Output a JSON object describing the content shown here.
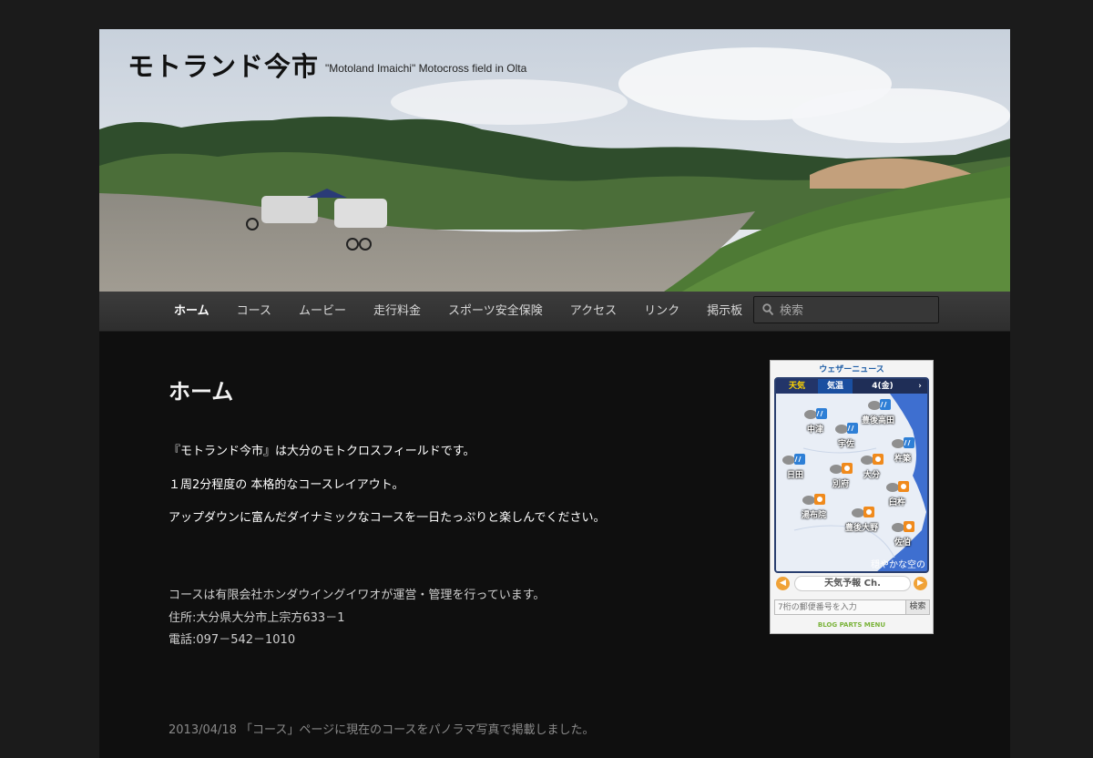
{
  "site": {
    "title": "モトランド今市",
    "description": "\"Motoland Imaichi\" Motocross field in Olta"
  },
  "nav": {
    "items": [
      "ホーム",
      "コース",
      "ムービー",
      "走行料金",
      "スポーツ安全保険",
      "アクセス",
      "リンク",
      "掲示板"
    ],
    "active": "ホーム",
    "search_placeholder": "検索"
  },
  "main": {
    "title": "ホーム",
    "paragraphs": [
      "『モトランド今市』は大分のモトクロスフィールドです。",
      "１周2分程度の 本格的なコースレイアウト。",
      "アップダウンに富んだダイナミックなコースを一日たっぷりと楽しんでください。"
    ],
    "info": [
      "コースは有限会社ホンダウイングイワオが運営・管理を行っています。",
      "住所:大分県大分市上宗方633－1",
      "電話:097－542－1010"
    ],
    "news": "2013/04/18 「コース」ページに現在のコースをパノラマ写真で掲載しました。"
  },
  "weather": {
    "brand": "ウェザーニュース",
    "tabs": [
      "天気",
      "気温"
    ],
    "date": "4(金)",
    "cities": [
      "中津",
      "豊後高田",
      "宇佐",
      "杵築",
      "日田",
      "別府",
      "大分",
      "臼杵",
      "湯布院",
      "豊後大野",
      "佐伯"
    ],
    "caption": "穏やかな空の",
    "channel": "天気予報 Ch.",
    "zip_placeholder": "7桁の郵便番号を入力",
    "search_label": "検索",
    "footer": "BLOG PARTS MENU"
  },
  "colors": {
    "page_bg": "#1b1b1b",
    "content_bg": "#0f0f0f",
    "nav_bg": "#383838",
    "map_sea": "#3e6fd0"
  }
}
